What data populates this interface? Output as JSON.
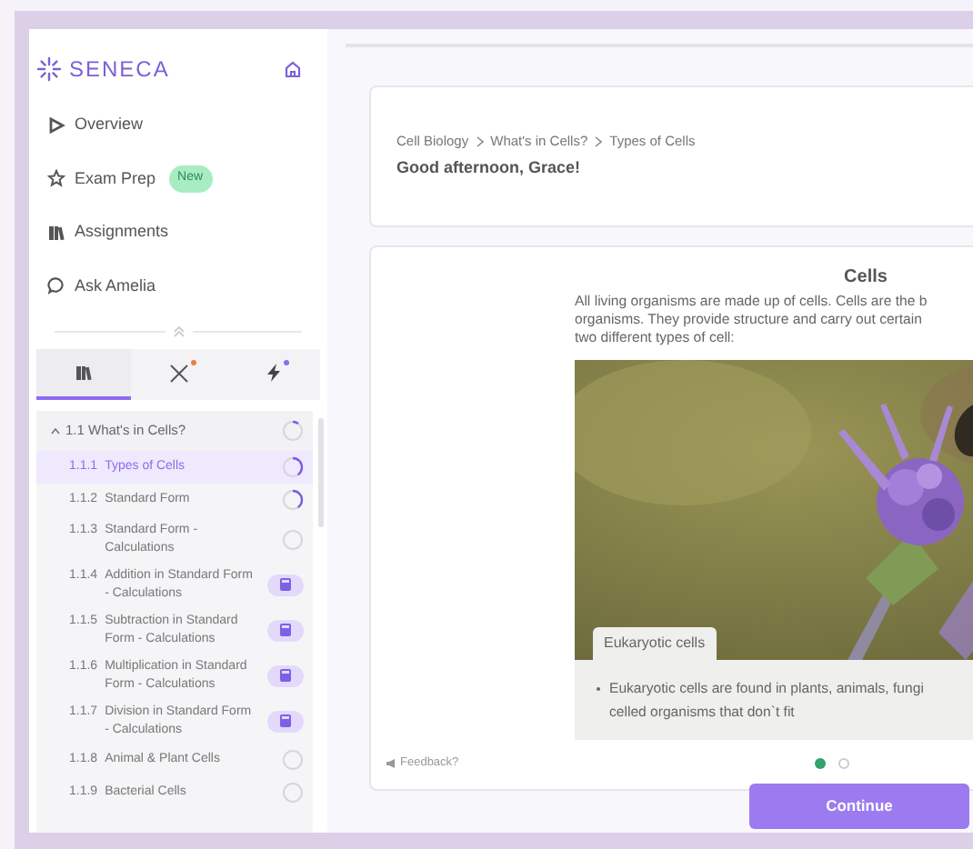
{
  "logo": "SENECA",
  "nav": [
    {
      "label": "Overview"
    },
    {
      "label": "Exam Prep",
      "badge": "New"
    },
    {
      "label": "Assignments"
    },
    {
      "label": "Ask Amelia"
    }
  ],
  "tabs": [
    {
      "selected": true
    },
    {
      "selected": false,
      "color": "#ee7b45"
    },
    {
      "selected": false,
      "color": "#8e6cf2"
    }
  ],
  "outline": {
    "title": "1.1 What's in Cells?",
    "expanded": true,
    "level": 0.1,
    "children": [
      {
        "number": "1.1.1",
        "title": "Types of Cells",
        "selected": true,
        "kind": "progress",
        "level": 0.4
      },
      {
        "number": "1.1.2",
        "title": "Standard Form",
        "selected": false,
        "kind": "progress",
        "level": 0.4
      },
      {
        "number": "1.1.3",
        "title": "Standard Form - Calculations",
        "selected": false,
        "kind": "progress",
        "level": 0
      },
      {
        "number": "1.1.4",
        "title": "Addition in Standard Form - Calculations",
        "selected": false,
        "kind": "locked"
      },
      {
        "number": "1.1.5",
        "title": "Subtraction in Standard Form - Calculations",
        "selected": false,
        "kind": "locked"
      },
      {
        "number": "1.1.6",
        "title": "Multiplication in Standard Form - Calculations",
        "selected": false,
        "kind": "locked"
      },
      {
        "number": "1.1.7",
        "title": "Division in Standard Form - Calculations",
        "selected": false,
        "kind": "locked"
      },
      {
        "number": "1.1.8",
        "title": "Animal & Plant Cells",
        "selected": false,
        "kind": "progress",
        "level": 0
      },
      {
        "number": "1.1.9",
        "title": "Bacterial Cells",
        "selected": false,
        "kind": "progress",
        "level": 0
      }
    ]
  },
  "breadcrumb": [
    "Cell Biology",
    "What's in Cells?",
    "Types of Cells"
  ],
  "greeting": "Good afternoon, Grace!",
  "lesson": {
    "title": "Cells",
    "intro_lines": [
      "All living organisms are made up of cells. Cells are the b",
      "organisms. They provide structure and carry out certain",
      "two different types of cell:"
    ],
    "picture": {
      "kind": "picture"
    },
    "caption_tab": "Eukaryotic cells",
    "bullet_lines": [
      "Eukaryotic cells are found in plants, animals, fungi",
      "celled organisms that don`t fit"
    ],
    "pager": [
      {
        "selected": true
      },
      {
        "selected": false
      }
    ],
    "feedback": "Feedback?",
    "continue": "Continue"
  }
}
